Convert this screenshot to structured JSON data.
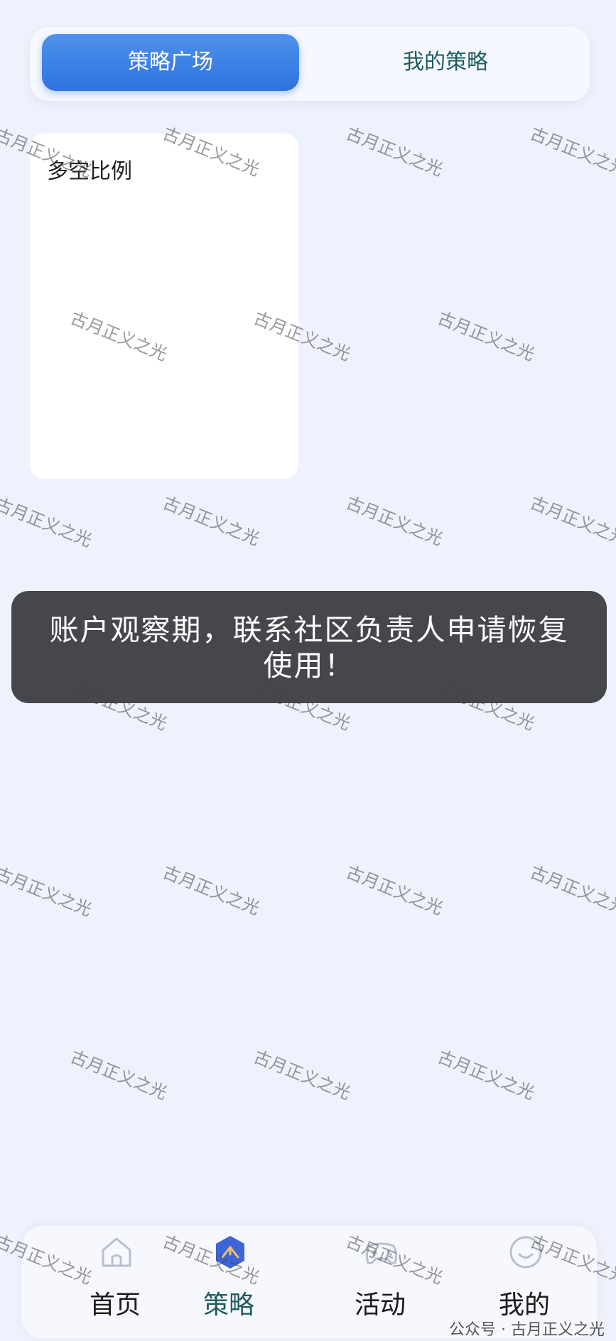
{
  "tabs": {
    "active_label": "策略广场",
    "inactive_label": "我的策略"
  },
  "card": {
    "title": "多空比例"
  },
  "toast": {
    "message": "账户观察期，联系社区负责人申请恢复使用！"
  },
  "bottom_nav": [
    {
      "label": "首页",
      "icon": "home-icon"
    },
    {
      "label": "策略",
      "icon": "strategy-icon"
    },
    {
      "label": "活动",
      "icon": "gamepad-icon"
    },
    {
      "label": "我的",
      "icon": "smile-icon"
    }
  ],
  "watermark": {
    "text": "古月正义之光"
  },
  "source_label": "公众号 · 古月正义之光",
  "colors": {
    "accent": "#2f72de",
    "active_nav": "#1f5b60",
    "toast_bg": "#46474c",
    "page_bg": "#eef2fc"
  }
}
